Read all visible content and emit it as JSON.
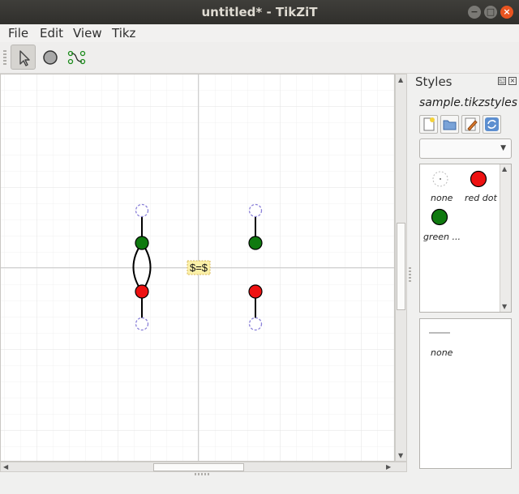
{
  "window": {
    "title": "untitled* - TikZiT",
    "minimize_glyph": "−",
    "maximize_glyph": "□",
    "close_glyph": "×"
  },
  "menu": {
    "items": [
      "File",
      "Edit",
      "View",
      "Tikz"
    ]
  },
  "toolbar": {
    "tools": [
      "select-tool",
      "node-tool",
      "edge-tool"
    ],
    "active_tool": "select-tool"
  },
  "canvas": {
    "label_node_text": "$=$",
    "grid": true,
    "colors": {
      "red": "#ee1111",
      "green": "#0f7a0f",
      "none_stroke": "#8a80d8",
      "label_fill": "#fbf0a8"
    }
  },
  "styles_panel": {
    "title": "Styles",
    "float_glyph": "◱",
    "close_glyph": "×",
    "filename": "sample.tikzstyles",
    "buttons": [
      "new-style-icon",
      "open-folder-icon",
      "edit-icon",
      "refresh-icon"
    ],
    "combo_value": "",
    "node_styles": [
      {
        "name": "none",
        "fill": "none"
      },
      {
        "name": "red dot",
        "fill": "#ee1111"
      },
      {
        "name": "green ...",
        "fill": "#0f7a0f"
      }
    ],
    "edge_styles": [
      {
        "name": "none"
      }
    ]
  }
}
